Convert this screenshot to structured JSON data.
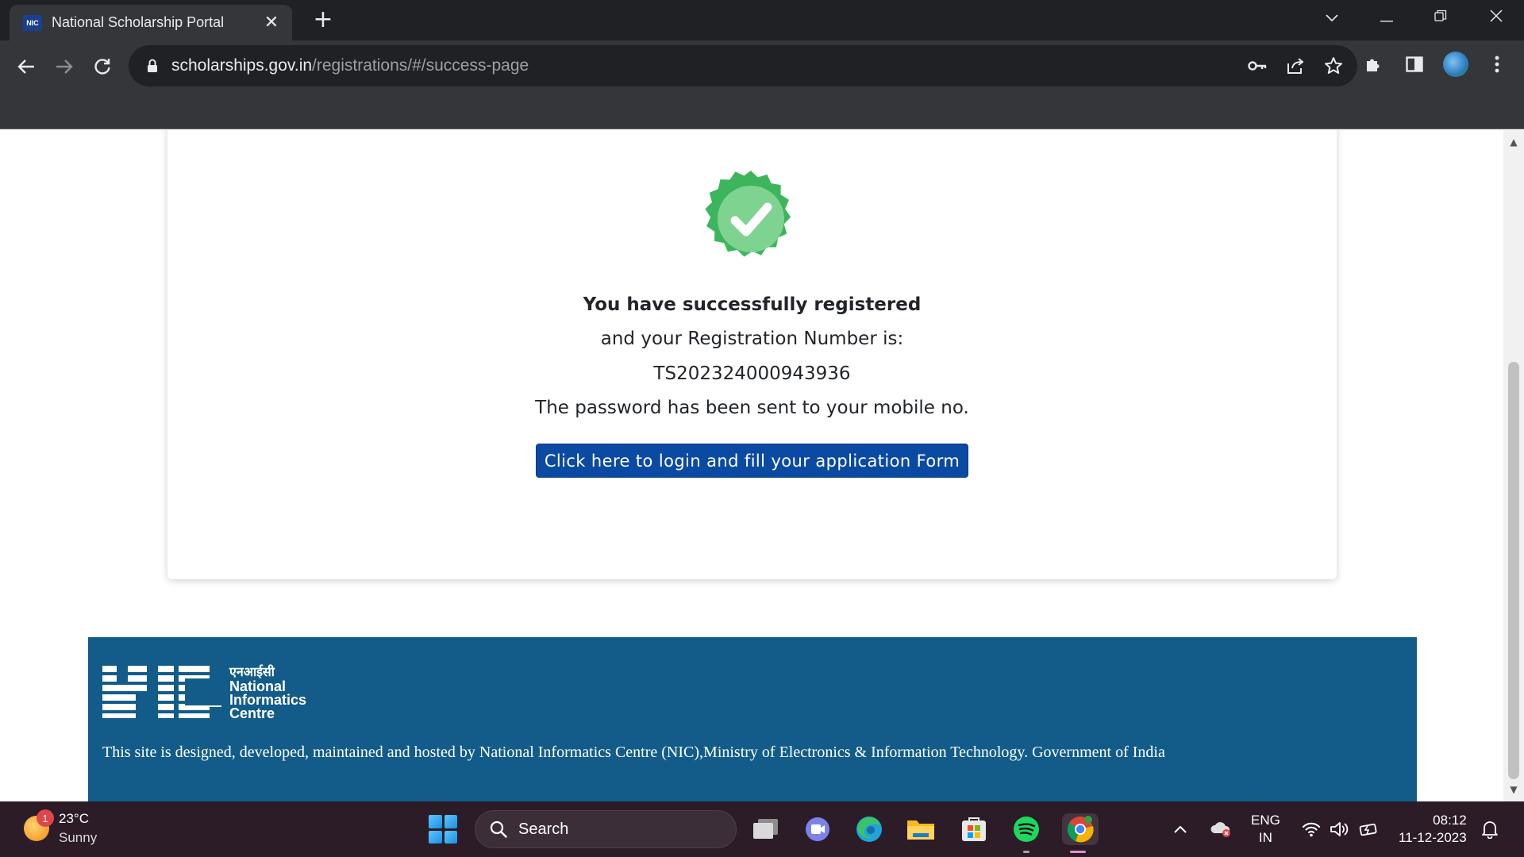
{
  "browser": {
    "tab_title": "National Scholarship Portal",
    "favicon_text": "NIC",
    "url_host": "scholarships.gov.in",
    "url_path": "/registrations/#/success-page"
  },
  "page": {
    "success_title": "You have successfully registered",
    "registration_label": "and your Registration Number is:",
    "registration_number": "TS202324000943936",
    "password_note": "The password has been sent to your mobile no.",
    "login_button": "Click here to login and fill your application Form",
    "footer_text": "This site is designed, developed, maintained and hosted by National Informatics Centre (NIC),Ministry of Electronics & Information Technology. Government of India",
    "nic_logo_hindi": "एनआईसी",
    "nic_logo_line1": "National",
    "nic_logo_line2": "Informatics",
    "nic_logo_line3": "Centre"
  },
  "colors": {
    "accent_green": "#3cb55c",
    "button_blue": "#0b4aa2",
    "footer_blue": "#135c8a"
  },
  "taskbar": {
    "weather_temp": "23°C",
    "weather_condition": "Sunny",
    "weather_badge": "1",
    "search_label": "Search",
    "lang_line1": "ENG",
    "lang_line2": "IN",
    "time": "08:12",
    "date": "11-12-2023"
  }
}
